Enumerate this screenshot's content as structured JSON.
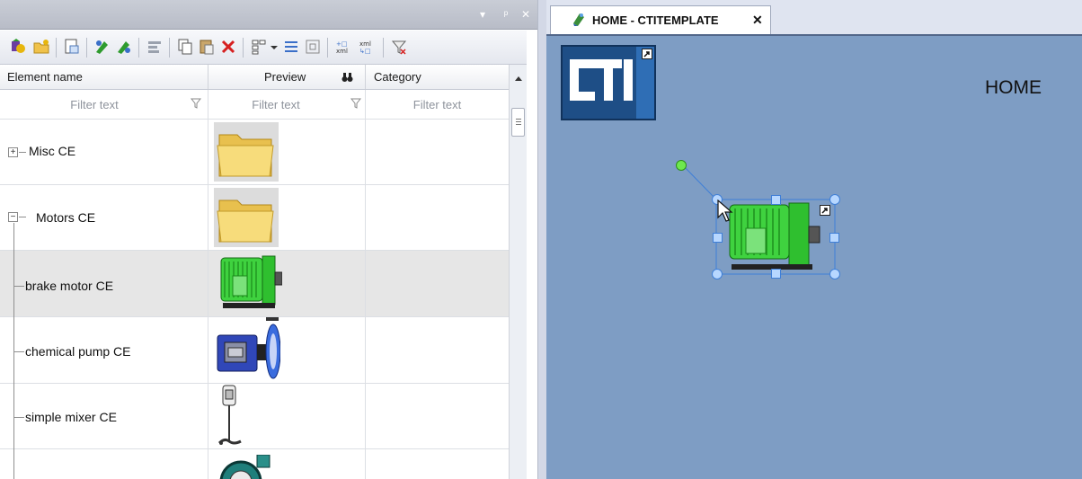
{
  "panel": {
    "titlebar_buttons": [
      "▾",
      "ᵖ",
      "✕"
    ],
    "columns": {
      "name": "Element name",
      "preview": "Preview",
      "category": "Category"
    },
    "filter_placeholder": "Filter text",
    "rows": [
      {
        "label": "Misc CE",
        "type": "folder",
        "expander": "+"
      },
      {
        "label": "Motors CE",
        "type": "folder",
        "expander": "−"
      },
      {
        "label": "brake motor CE",
        "type": "motor",
        "selected": true
      },
      {
        "label": "chemical pump CE",
        "type": "pump"
      },
      {
        "label": "simple mixer CE",
        "type": "mixer"
      },
      {
        "label": "",
        "type": "pump2"
      }
    ]
  },
  "document": {
    "tab_title": "HOME - CTITEMPLATE",
    "tab_close": "✕",
    "logo_text": "CTi",
    "home_label": "HOME"
  },
  "colors": {
    "canvas": "#7e9dc4",
    "logo_blue": "#1e4e86",
    "motor_green": "#33cc33",
    "selection_blue": "#3f7fd7"
  }
}
